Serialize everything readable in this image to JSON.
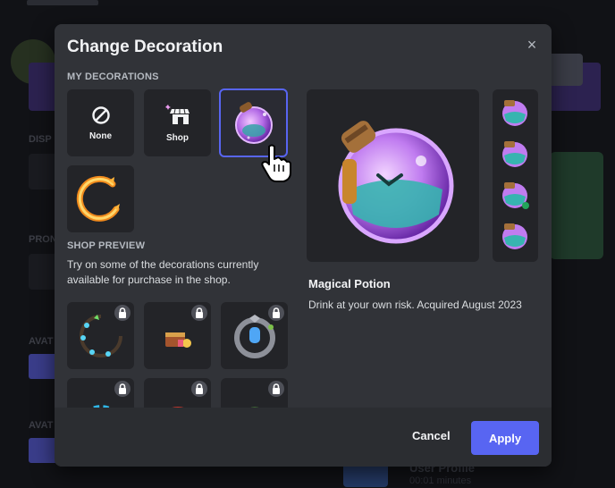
{
  "modal": {
    "title": "Change Decoration",
    "close_label": "×"
  },
  "my_decorations": {
    "heading": "MY DECORATIONS",
    "items": [
      {
        "label": "None",
        "icon": "none-icon"
      },
      {
        "label": "Shop",
        "icon": "shop-icon"
      },
      {
        "label": "",
        "icon": "magical-potion-decoration",
        "selected": true
      },
      {
        "label": "",
        "icon": "fire-ring-decoration"
      }
    ]
  },
  "shop_preview": {
    "heading": "SHOP PREVIEW",
    "description": "Try on some of the decorations currently available for purchase in the shop.",
    "items": [
      {
        "icon": "crystal-vine-decoration",
        "locked": true
      },
      {
        "icon": "treasure-decoration",
        "locked": true
      },
      {
        "icon": "gem-frame-decoration",
        "locked": true
      },
      {
        "icon": "blue-crystal-ring-decoration",
        "locked": true
      },
      {
        "icon": "red-ring-decoration",
        "locked": true
      },
      {
        "icon": "green-ring-decoration",
        "locked": true
      }
    ]
  },
  "selected_decoration": {
    "name": "Magical Potion",
    "description": "Drink at your own risk. Acquired August 2023"
  },
  "footer": {
    "cancel_label": "Cancel",
    "apply_label": "Apply"
  },
  "colors": {
    "accent": "#5865f2",
    "modal_bg": "#313338",
    "tile_bg": "#232428"
  },
  "background_app": {
    "profile_title": "User Profile",
    "profile_meta": "00:01 minutes"
  }
}
